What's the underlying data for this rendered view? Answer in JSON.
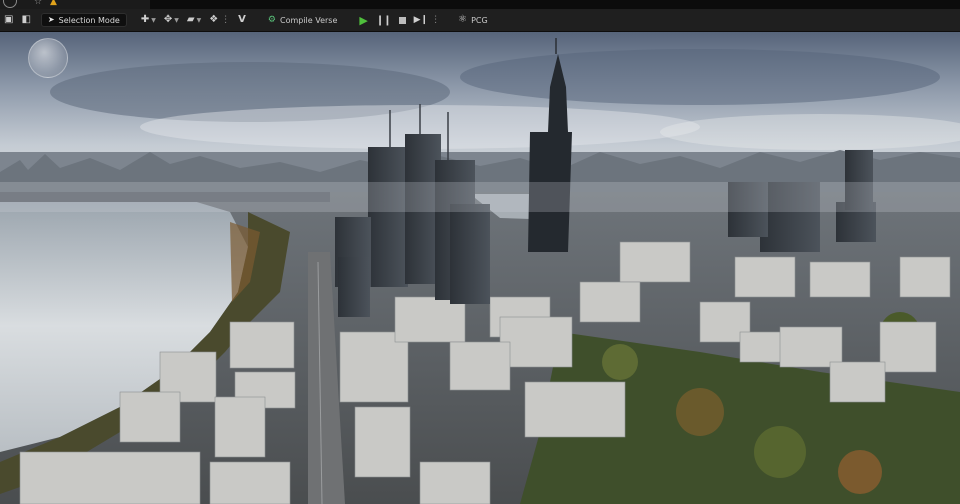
{
  "toolbar": {
    "selection_mode": "Selection Mode",
    "compile_label": "Compile Verse",
    "pcg_label": "PCG",
    "icons": [
      "save-icon",
      "content-icon",
      "select-arrow-icon",
      "add-actor-icon",
      "transform-icon",
      "camera-icon",
      "cinematics-icon",
      "verse-icon",
      "compile-icon",
      "play-icon",
      "pause-icon",
      "stop-icon",
      "skip-frame-icon",
      "pcg-icon"
    ]
  },
  "colors": {
    "toolbar_bg": "#1f1f1f",
    "play_green": "#4fbf3c",
    "warning": "#e0a21b",
    "sky_top": "#6f7f95",
    "water": "#c9cfd6"
  }
}
